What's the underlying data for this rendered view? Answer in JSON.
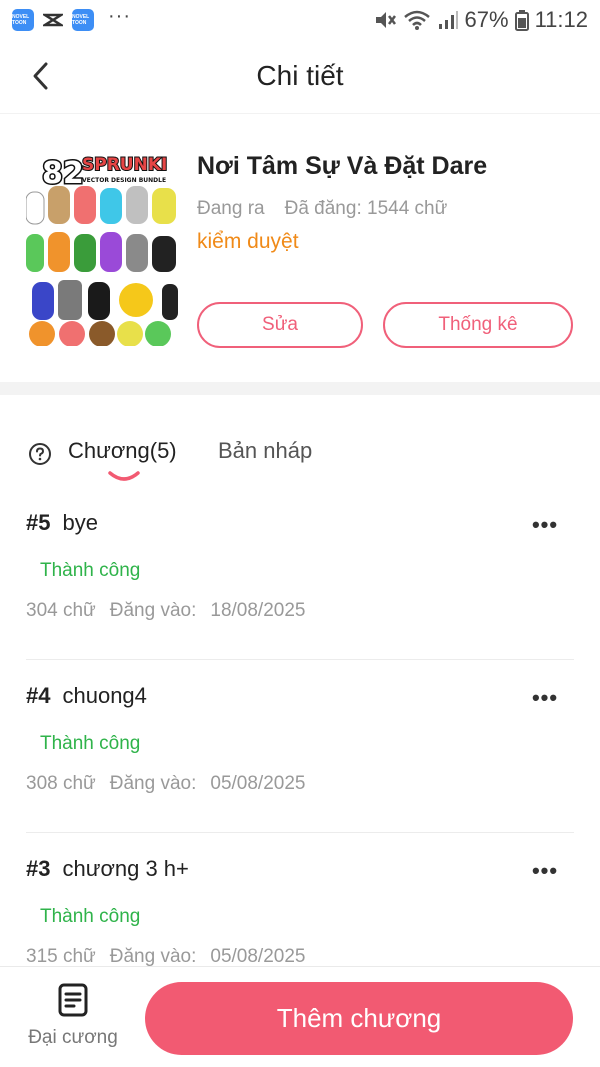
{
  "status_bar": {
    "app_icon_1": "NOVEL TOON",
    "app_icon_2": "NOVEL TOON",
    "more": "···",
    "battery": "67%",
    "time": "11:12"
  },
  "header": {
    "title": "Chi tiết"
  },
  "book": {
    "cover": {
      "logo_number": "82",
      "logo_word": "SPRUNKI",
      "logo_subtitle": "VECTOR DESIGN BUNDLE"
    },
    "title": "Nơi Tâm Sự Và Đặt Dare",
    "publish_status": "Đang ra",
    "word_count": "Đã đăng: 1544 chữ",
    "review_status": "kiểm duyệt",
    "edit_label": "Sửa",
    "stats_label": "Thống kê"
  },
  "tabs": {
    "chapters_label": "Chương(5)",
    "drafts_label": "Bản nháp"
  },
  "chapters": [
    {
      "number": "#5",
      "title": "bye",
      "status": "Thành công",
      "words": "304 chữ",
      "posted_label": "Đăng vào:",
      "date": "18/08/2025"
    },
    {
      "number": "#4",
      "title": "chuong4",
      "status": "Thành công",
      "words": "308 chữ",
      "posted_label": "Đăng vào:",
      "date": "05/08/2025"
    },
    {
      "number": "#3",
      "title": "chương 3 h+",
      "status": "Thành công",
      "words": "315 chữ",
      "posted_label": "Đăng vào:",
      "date": "05/08/2025"
    }
  ],
  "bottom_bar": {
    "outline_label": "Đại cương",
    "add_chapter_label": "Thêm chương"
  },
  "colors": {
    "accent": "#f25a72",
    "success": "#2fb34a",
    "warning": "#f08a18"
  }
}
